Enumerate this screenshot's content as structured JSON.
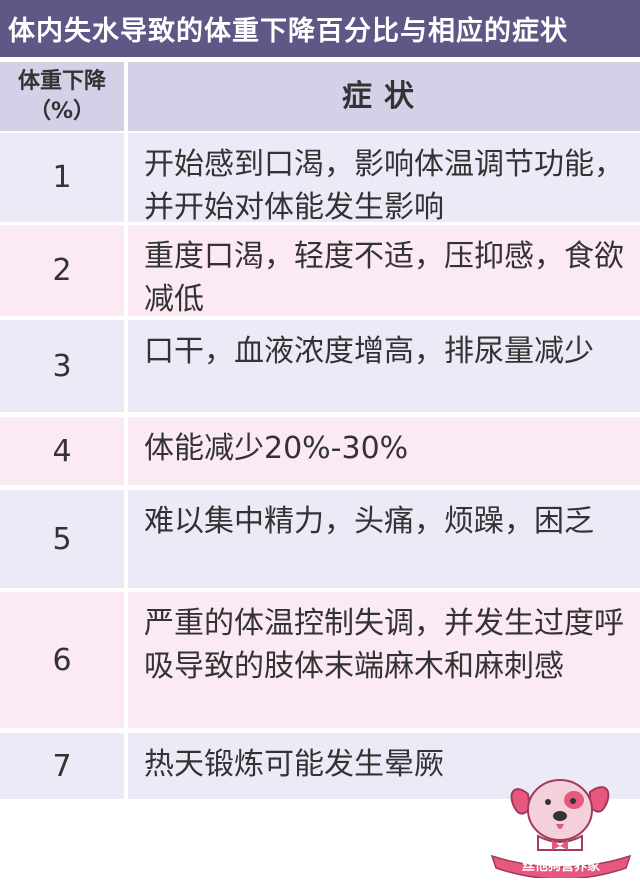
{
  "title": "体内失水导致的体重下降百分比与相应的症状",
  "header": {
    "col1_line1": "体重下降",
    "col1_line2": "（%）",
    "col2": "症状"
  },
  "rows": [
    {
      "percent": "1",
      "symptom": "开始感到口渴，影响体温调节功能，并开始对体能发生影响"
    },
    {
      "percent": "2",
      "symptom": "重度口渴，轻度不适，压抑感，食欲减低"
    },
    {
      "percent": "3",
      "symptom": "口干，血液浓度增高，排尿量减少"
    },
    {
      "percent": "4",
      "symptom": "体能减少20%-30%"
    },
    {
      "percent": "5",
      "symptom": "难以集中精力，头痛，烦躁，困乏"
    },
    {
      "percent": "6",
      "symptom": "严重的体温控制失调，并发生过度呼吸导致的肢体末端麻木和麻刺感"
    },
    {
      "percent": "7",
      "symptom": "热天锻炼可能发生晕厥"
    }
  ],
  "watermark": "丝他狗营养家",
  "colors": {
    "title_bg": "#5f5887",
    "header_bg": "#d4d0e8",
    "row_lavender": "#eceaf7",
    "row_pink": "#fbe9f4",
    "text": "#333333"
  }
}
